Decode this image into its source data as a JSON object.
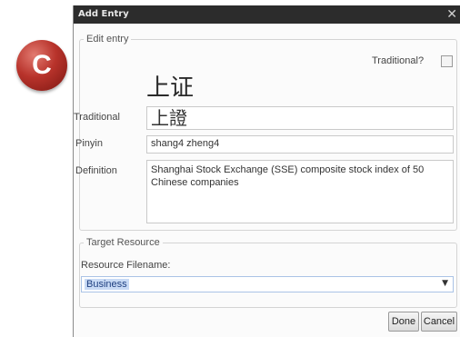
{
  "badge": {
    "letter": "C"
  },
  "dialog": {
    "title": "Add Entry",
    "close_glyph": "✕",
    "edit_group": {
      "legend": "Edit entry",
      "traditional_checkbox_label": "Traditional?",
      "traditional_checked": false,
      "simplified_chars": "上证",
      "fields": {
        "traditional": {
          "label": "Traditional",
          "value": "上證"
        },
        "pinyin": {
          "label": "Pinyin",
          "value": "shang4 zheng4"
        },
        "definition": {
          "label": "Definition",
          "value": "Shanghai Stock Exchange (SSE) composite stock index of 50 Chinese companies"
        }
      }
    },
    "target_group": {
      "legend": "Target Resource",
      "filename_label": "Resource Filename:",
      "selected": "Business"
    },
    "buttons": {
      "done": "Done",
      "cancel": "Cancel"
    }
  }
}
